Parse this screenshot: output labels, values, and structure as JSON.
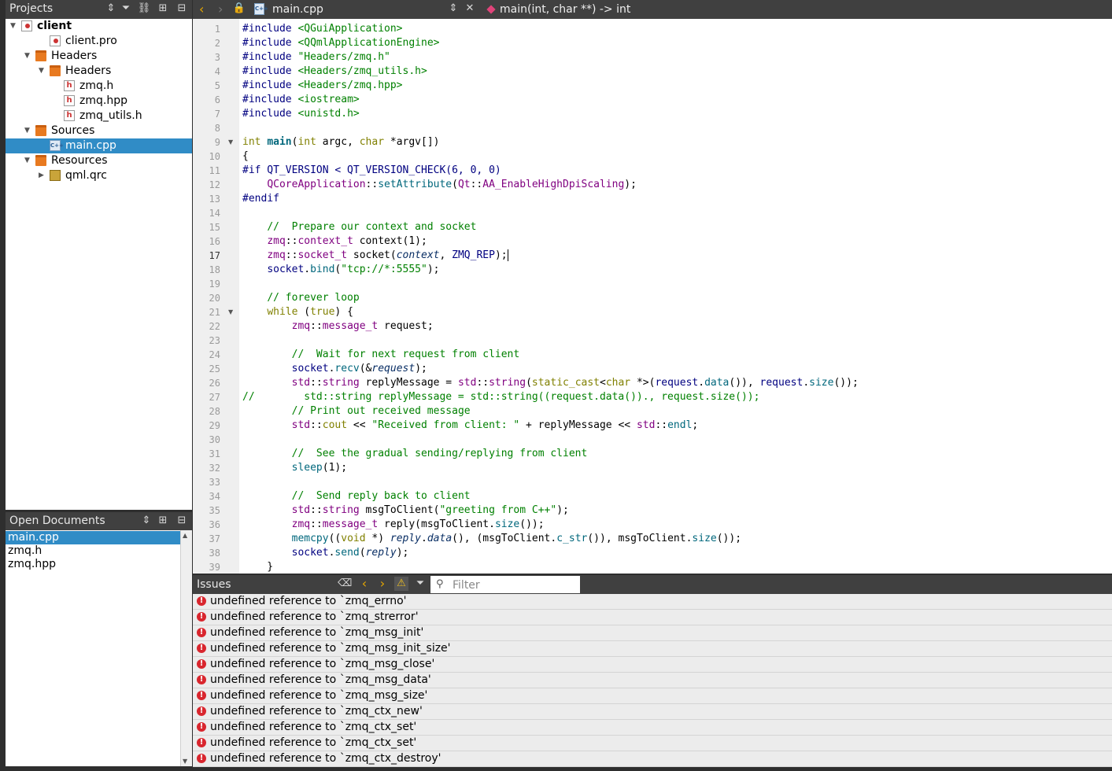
{
  "projects": {
    "title": "Projects",
    "tree": [
      {
        "label": "client",
        "icon": "project",
        "depth": 0,
        "arrow": "down",
        "bold": true
      },
      {
        "label": "client.pro",
        "icon": "pro-file",
        "depth": 2
      },
      {
        "label": "Headers",
        "icon": "folder",
        "depth": 1,
        "arrow": "down"
      },
      {
        "label": "Headers",
        "icon": "folder",
        "depth": 2,
        "arrow": "down"
      },
      {
        "label": "zmq.h",
        "icon": "header-file",
        "depth": 3
      },
      {
        "label": "zmq.hpp",
        "icon": "header-file",
        "depth": 3
      },
      {
        "label": "zmq_utils.h",
        "icon": "header-file",
        "depth": 3
      },
      {
        "label": "Sources",
        "icon": "folder",
        "depth": 1,
        "arrow": "down"
      },
      {
        "label": "main.cpp",
        "icon": "cpp-file",
        "depth": 2,
        "selected": true
      },
      {
        "label": "Resources",
        "icon": "resource-folder",
        "depth": 1,
        "arrow": "down"
      },
      {
        "label": "qml.qrc",
        "icon": "qrc-file",
        "depth": 2,
        "arrow": "right"
      }
    ]
  },
  "open_documents": {
    "title": "Open Documents",
    "items": [
      {
        "label": "main.cpp",
        "selected": true
      },
      {
        "label": "zmq.h"
      },
      {
        "label": "zmq.hpp"
      }
    ]
  },
  "editor": {
    "file_name": "main.cpp",
    "function_signature": "main(int, char **) -> int",
    "current_line": 17,
    "fold_lines": [
      9,
      21
    ],
    "lines": [
      "1",
      "2",
      "3",
      "4",
      "5",
      "6",
      "7",
      "8",
      "9",
      "10",
      "11",
      "12",
      "13",
      "14",
      "15",
      "16",
      "17",
      "18",
      "19",
      "20",
      "21",
      "22",
      "23",
      "24",
      "25",
      "26",
      "27",
      "28",
      "29",
      "30",
      "31",
      "32",
      "33",
      "34",
      "35",
      "36",
      "37",
      "38",
      "39"
    ]
  },
  "issues": {
    "title": "Issues",
    "filter_placeholder": "Filter",
    "items": [
      "undefined reference to `zmq_errno'",
      "undefined reference to `zmq_strerror'",
      "undefined reference to `zmq_msg_init'",
      "undefined reference to `zmq_msg_init_size'",
      "undefined reference to `zmq_msg_close'",
      "undefined reference to `zmq_msg_data'",
      "undefined reference to `zmq_msg_size'",
      "undefined reference to `zmq_ctx_new'",
      "undefined reference to `zmq_ctx_set'",
      "undefined reference to `zmq_ctx_set'",
      "undefined reference to `zmq_ctx_destroy'"
    ]
  },
  "icons": {
    "sort": "updown-arrows-icon",
    "filter": "filter-icon",
    "link": "link-icon",
    "split": "split-icon",
    "close": "close-pane-icon",
    "back": "chevron-left-icon",
    "forward": "chevron-right-icon",
    "lock": "lock-icon",
    "error": "error-icon",
    "warning": "warning-icon"
  },
  "colors": {
    "selection": "#308cc6",
    "keyword": "#808000",
    "comment": "#008000",
    "error": "#d9262e"
  }
}
